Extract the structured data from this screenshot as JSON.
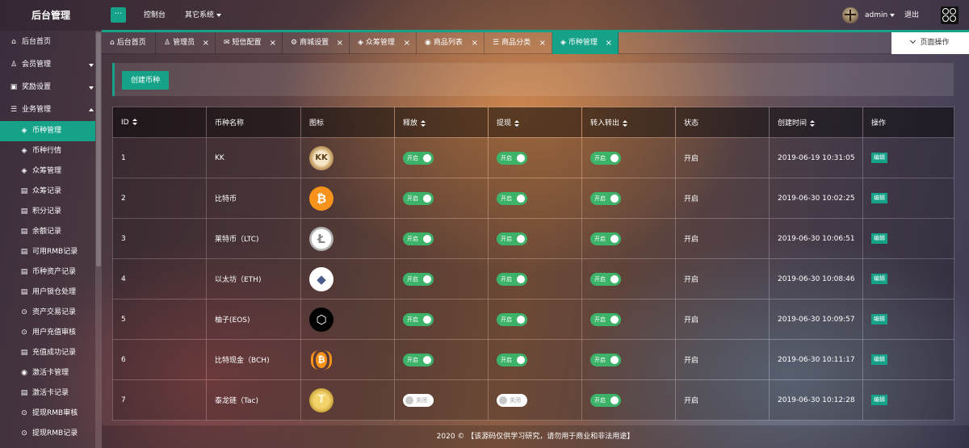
{
  "header": {
    "brand": "后台管理",
    "menu_toggle": "···",
    "nav": [
      {
        "label": "控制台"
      },
      {
        "label": "其它系统"
      }
    ],
    "user": "admin",
    "logout": "退出"
  },
  "sidebar": {
    "items": [
      {
        "label": "后台首页",
        "icon": "home-icon"
      },
      {
        "label": "会员管理",
        "icon": "user-icon"
      },
      {
        "label": "奖励设置",
        "icon": "gift-icon"
      },
      {
        "label": "业务管理",
        "icon": "list-icon"
      },
      {
        "label": "币种管理",
        "icon": "coin-icon",
        "active": true
      },
      {
        "label": "币种行情",
        "icon": "coin-icon"
      },
      {
        "label": "众筹管理",
        "icon": "coin-icon"
      },
      {
        "label": "众筹记录",
        "icon": "record-icon"
      },
      {
        "label": "积分记录",
        "icon": "record-icon"
      },
      {
        "label": "余额记录",
        "icon": "record-icon"
      },
      {
        "label": "可用RMB记录",
        "icon": "record-icon"
      },
      {
        "label": "币种资产记录",
        "icon": "record-icon"
      },
      {
        "label": "用户锁仓处理",
        "icon": "record-icon"
      },
      {
        "label": "资产交易记录",
        "icon": "cycle-icon"
      },
      {
        "label": "用户充值审核",
        "icon": "cycle-icon"
      },
      {
        "label": "充值成功记录",
        "icon": "record-icon"
      },
      {
        "label": "激活卡管理",
        "icon": "circle-icon"
      },
      {
        "label": "激活卡记录",
        "icon": "record-icon"
      },
      {
        "label": "提现RMB审核",
        "icon": "cycle-icon"
      },
      {
        "label": "提现RMB记录",
        "icon": "cycle-icon"
      }
    ]
  },
  "tabs": [
    {
      "label": "后台首页",
      "icon": "home-icon"
    },
    {
      "label": "管理员",
      "icon": "user-icon"
    },
    {
      "label": "短信配置",
      "icon": "mail-icon"
    },
    {
      "label": "商城设置",
      "icon": "gear-icon"
    },
    {
      "label": "众筹管理",
      "icon": "coin-icon"
    },
    {
      "label": "商品列表",
      "icon": "circle-icon"
    },
    {
      "label": "商品分类",
      "icon": "list-icon"
    },
    {
      "label": "币种管理",
      "icon": "coin-icon",
      "active": true
    }
  ],
  "page_ops": "页面操作",
  "toolbar": {
    "create_label": "创建币种"
  },
  "table": {
    "headers": [
      "ID",
      "币种名称",
      "图标",
      "释放",
      "提现",
      "转入转出",
      "状态",
      "创建时间",
      "操作"
    ],
    "rows": [
      {
        "id": "1",
        "name": "KK",
        "icon": "kk-coin-icon",
        "release": "开启",
        "withdraw": "开启",
        "transfer": "开启",
        "status": "开启",
        "created": "2019-06-19 10:31:05",
        "action": "编辑"
      },
      {
        "id": "2",
        "name": "比特币",
        "icon": "bitcoin-icon",
        "release": "开启",
        "withdraw": "开启",
        "transfer": "开启",
        "status": "开启",
        "created": "2019-06-30 10:02:25",
        "action": "编辑"
      },
      {
        "id": "3",
        "name": "莱特币（LTC)",
        "icon": "litecoin-icon",
        "release": "开启",
        "withdraw": "开启",
        "transfer": "开启",
        "status": "开启",
        "created": "2019-06-30 10:06:51",
        "action": "编辑"
      },
      {
        "id": "4",
        "name": "以太坊（ETH)",
        "icon": "ethereum-icon",
        "release": "开启",
        "withdraw": "开启",
        "transfer": "开启",
        "status": "开启",
        "created": "2019-06-30 10:08:46",
        "action": "编辑"
      },
      {
        "id": "5",
        "name": "柚子(EOS)",
        "icon": "eos-icon",
        "release": "开启",
        "withdraw": "开启",
        "transfer": "开启",
        "status": "开启",
        "created": "2019-06-30 10:09:57",
        "action": "编辑"
      },
      {
        "id": "6",
        "name": "比特现金（BCH)",
        "icon": "bitcoin-cash-icon",
        "release": "开启",
        "withdraw": "开启",
        "transfer": "开启",
        "status": "开启",
        "created": "2019-06-30 10:11:17",
        "action": "编辑"
      },
      {
        "id": "7",
        "name": "泰龙链（Tac)",
        "icon": "tac-coin-icon",
        "release": "关闭",
        "withdraw": "关闭",
        "transfer": "开启",
        "status": "开启",
        "created": "2019-06-30 10:12:28",
        "action": "编辑"
      }
    ]
  },
  "footer": "2020 © 【该源码仅供学习研究，请勿用于商业和非法用途】",
  "colors": {
    "accent": "#16a289",
    "switch_on": "#3db36a"
  }
}
